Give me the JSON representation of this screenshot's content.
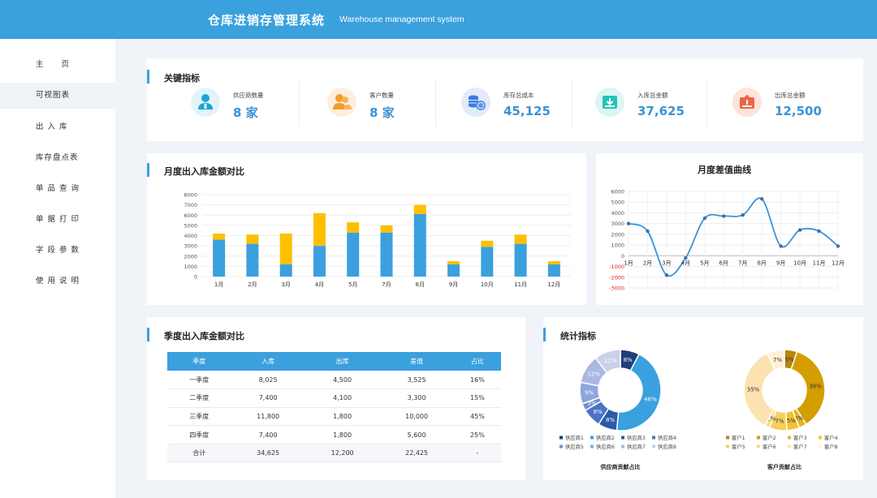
{
  "header": {
    "title": "仓库进销存管理系统",
    "subtitle": "Warehouse management system"
  },
  "nav": [
    "主　　页",
    "可视图表",
    "出 入 库",
    "库存盘点表",
    "单 品 查 询",
    "单 据 打 印",
    "字 段 参 数",
    "使 用 说 明"
  ],
  "kpi_card": {
    "title": "关键指标"
  },
  "kpis": [
    {
      "label": "供应商数量",
      "value": "8 家",
      "icon": "supplier-user-icon",
      "icon_color": "#1aa6d6",
      "bg": "#e3f3fa"
    },
    {
      "label": "客户数量",
      "value": "8 家",
      "icon": "customer-group-icon",
      "icon_color": "#f39c2b",
      "bg": "#fdefdc"
    },
    {
      "label": "库存总成本",
      "value": "45,125",
      "icon": "coins-icon",
      "icon_color": "#3d7ae0",
      "bg": "#e2ebfa"
    },
    {
      "label": "入库总金额",
      "value": "37,625",
      "icon": "inbox-download-icon",
      "icon_color": "#22c4b8",
      "bg": "#dcf6f3"
    },
    {
      "label": "出库总金额",
      "value": "12,500",
      "icon": "outbox-upload-icon",
      "icon_color": "#ec6546",
      "bg": "#fde3dc"
    }
  ],
  "monthly_card": {
    "title": "月度出入库金额对比"
  },
  "diff_card": {
    "title": "月度差值曲线"
  },
  "quarter_card": {
    "title": "季度出入库金额对比"
  },
  "stats_card": {
    "title": "统计指标"
  },
  "quarter_table": {
    "headers": [
      "季度",
      "入库",
      "出库",
      "差值",
      "占比"
    ],
    "rows": [
      [
        "一季度",
        "8,025",
        "4,500",
        "3,525",
        "16%"
      ],
      [
        "二季度",
        "7,400",
        "4,100",
        "3,300",
        "15%"
      ],
      [
        "三季度",
        "11,800",
        "1,800",
        "10,000",
        "45%"
      ],
      [
        "四季度",
        "7,400",
        "1,800",
        "5,600",
        "25%"
      ]
    ],
    "total": [
      "合计",
      "34,625",
      "12,200",
      "22,425",
      "-"
    ]
  },
  "colors": {
    "primary": "#3aa0de",
    "bar_in": "#3aa0de",
    "bar_out": "#fdc000",
    "negative": "#e02020"
  },
  "chart_data": [
    {
      "type": "bar",
      "title": "",
      "categories": [
        "1月",
        "2月",
        "3月",
        "4月",
        "5月",
        "7月",
        "8月",
        "9月",
        "10月",
        "11月",
        "12月"
      ],
      "stacked": true,
      "series": [
        {
          "name": "",
          "values": [
            3600,
            3200,
            1200,
            3000,
            4300,
            4300,
            6100,
            1200,
            2900,
            3200,
            1200
          ]
        },
        {
          "name": "",
          "values": [
            600,
            900,
            3000,
            3200,
            1000,
            700,
            900,
            300,
            600,
            900,
            300
          ]
        }
      ],
      "yticks": [
        0,
        1000,
        2000,
        3000,
        4000,
        5000,
        6000,
        7000,
        8000
      ],
      "ylim": [
        0,
        8000
      ],
      "grid": true
    },
    {
      "type": "line",
      "title": "月度差值曲线",
      "categories": [
        "1月",
        "2月",
        "3月",
        "4月",
        "5月",
        "6月",
        "7月",
        "8月",
        "9月",
        "10月",
        "11月",
        "12月"
      ],
      "series": [
        {
          "name": "",
          "values": [
            3000,
            2300,
            -1800,
            -200,
            3500,
            3700,
            3800,
            5300,
            900,
            2400,
            2300,
            900
          ]
        }
      ],
      "yticks": [
        -3000,
        -2000,
        -1000,
        0,
        1000,
        2000,
        3000,
        4000,
        5000,
        6000
      ],
      "ylim": [
        -3000,
        6000
      ],
      "grid": true
    },
    {
      "type": "pie",
      "title": "供应商贡献占比",
      "labels": [
        "供应商1",
        "供应商2",
        "供应商3",
        "供应商4",
        "供应商5",
        "供应商6",
        "供应商7",
        "供应商8"
      ],
      "values": [
        8,
        46,
        8,
        8,
        3,
        9,
        12,
        11
      ],
      "value_labels": [
        "8%",
        "46%",
        "8%",
        "8%",
        "3%",
        "9%",
        "12%",
        "11%"
      ],
      "colors": [
        "#1e3f7a",
        "#3aa0de",
        "#2c5aa8",
        "#4a72c6",
        "#6f8fd6",
        "#8ea6de",
        "#aab8e2",
        "#c9d1ea"
      ]
    },
    {
      "type": "pie",
      "title": "客户贡献占比",
      "labels": [
        "客户1",
        "客户2",
        "客户3",
        "客户4",
        "客户5",
        "客户6",
        "客户7",
        "客户8"
      ],
      "values": [
        5,
        36,
        3,
        5,
        7,
        2,
        35,
        7
      ],
      "value_labels": [
        "5%",
        "36%",
        "3%",
        "5%",
        "7%",
        "2%",
        "35%",
        "7%"
      ],
      "colors": [
        "#b8860b",
        "#d49d00",
        "#e6b422",
        "#f2c233",
        "#f6cf5c",
        "#f9dc85",
        "#fce2b0",
        "#fdf0d6"
      ]
    }
  ]
}
